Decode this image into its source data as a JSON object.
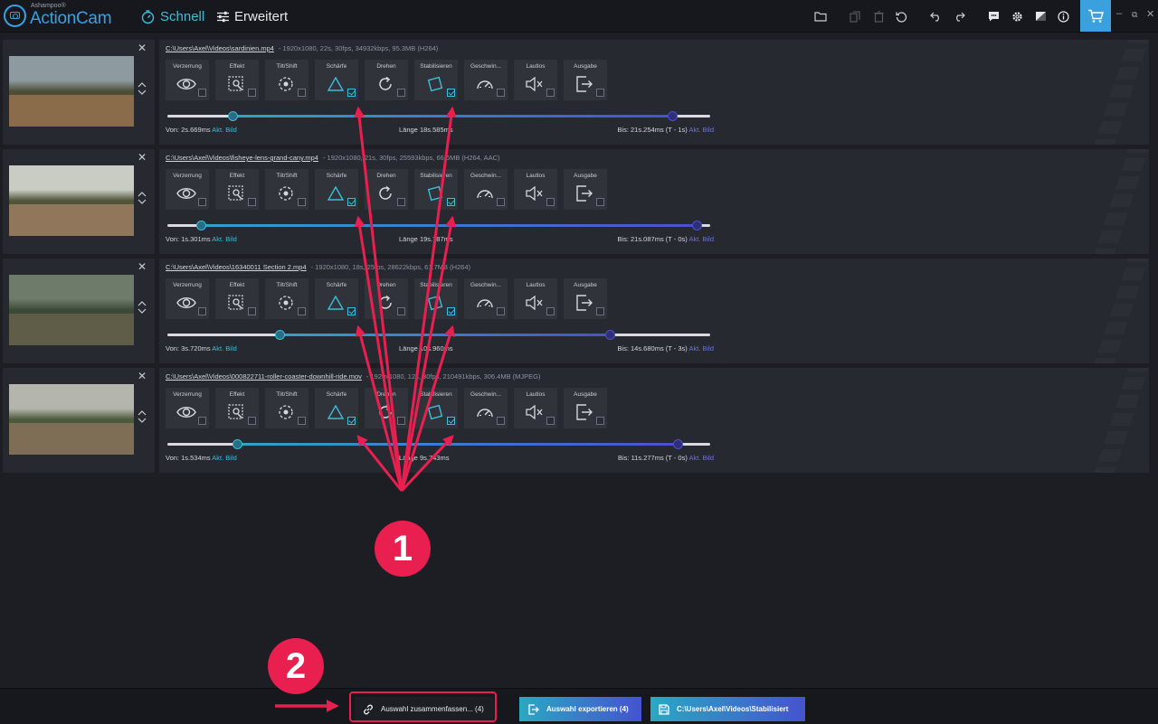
{
  "app": {
    "brand_small": "Ashampoo®",
    "brand": "ActionCam",
    "modes": [
      {
        "label": "Schnell",
        "active": true
      },
      {
        "label": "Erweitert",
        "active": false
      }
    ]
  },
  "tool_labels": [
    "Verzerrung",
    "Effekt",
    "Tilt/Shift",
    "Schärfe",
    "Drehen",
    "Stabilisieren",
    "Geschwin...",
    "Lautlos",
    "Ausgabe"
  ],
  "videos": [
    {
      "path": "C:\\Users\\Axel\\Videos\\sardinien.mp4",
      "meta": "-  1920x1080, 22s, 30fps, 34932kbps, 95.3MB (H264)",
      "von": "Von: 2s.669ms",
      "laenge": "Länge 18s.585ms",
      "bis": "Bis: 21s.254ms (T - 1s)",
      "akt": "Akt. Bild",
      "start_fraction": 0.12,
      "end_fraction": 0.93,
      "checked": [
        false,
        false,
        false,
        true,
        false,
        true,
        false,
        false,
        false
      ]
    },
    {
      "path": "C:\\Users\\Axel\\Videos\\fisheye-lens-grand-cany.mp4",
      "meta": "-  1920x1080, 21s, 30fps, 25593kbps, 66.6MB (H264, AAC)",
      "von": "Von: 1s.301ms",
      "laenge": "Länge 19s.787ms",
      "bis": "Bis: 21s.087ms (T - 0s)",
      "akt": "Akt. Bild",
      "start_fraction": 0.062,
      "end_fraction": 0.975,
      "checked": [
        false,
        false,
        false,
        true,
        false,
        true,
        false,
        false,
        false
      ]
    },
    {
      "path": "C:\\Users\\Axel\\Videos\\16340011 Section 2.mp4",
      "meta": "-  1920x1080, 18s, 25fps, 28622kbps, 61.7MB (H264)",
      "von": "Von: 3s.720ms",
      "laenge": "Länge 10s.960ms",
      "bis": "Bis: 14s.680ms (T - 3s)",
      "akt": "Akt. Bild",
      "start_fraction": 0.207,
      "end_fraction": 0.815,
      "checked": [
        false,
        false,
        false,
        true,
        false,
        true,
        false,
        false,
        false
      ]
    },
    {
      "path": "C:\\Users\\Axel\\Videos\\000822711-roller-coaster-downhill-ride.mov",
      "meta": "-  1920x1080, 12s, 30fps, 210491kbps, 306.4MB (MJPEG)",
      "von": "Von: 1s.534ms",
      "laenge": "Länge 9s.743ms",
      "bis": "Bis: 11s.277ms (T - 0s)",
      "akt": "Akt. Bild",
      "start_fraction": 0.128,
      "end_fraction": 0.94,
      "checked": [
        false,
        false,
        false,
        true,
        false,
        true,
        false,
        false,
        false
      ]
    }
  ],
  "bottom": {
    "merge_label": "Auswahl zusammenfassen... (4)",
    "export_label": "Auswahl exportieren (4)",
    "folder_label": "C:\\Users\\Axel\\Videos\\Stabilisiert"
  },
  "annotations": {
    "marker_1": "1",
    "marker_2": "2",
    "color": "#e81f4f"
  }
}
